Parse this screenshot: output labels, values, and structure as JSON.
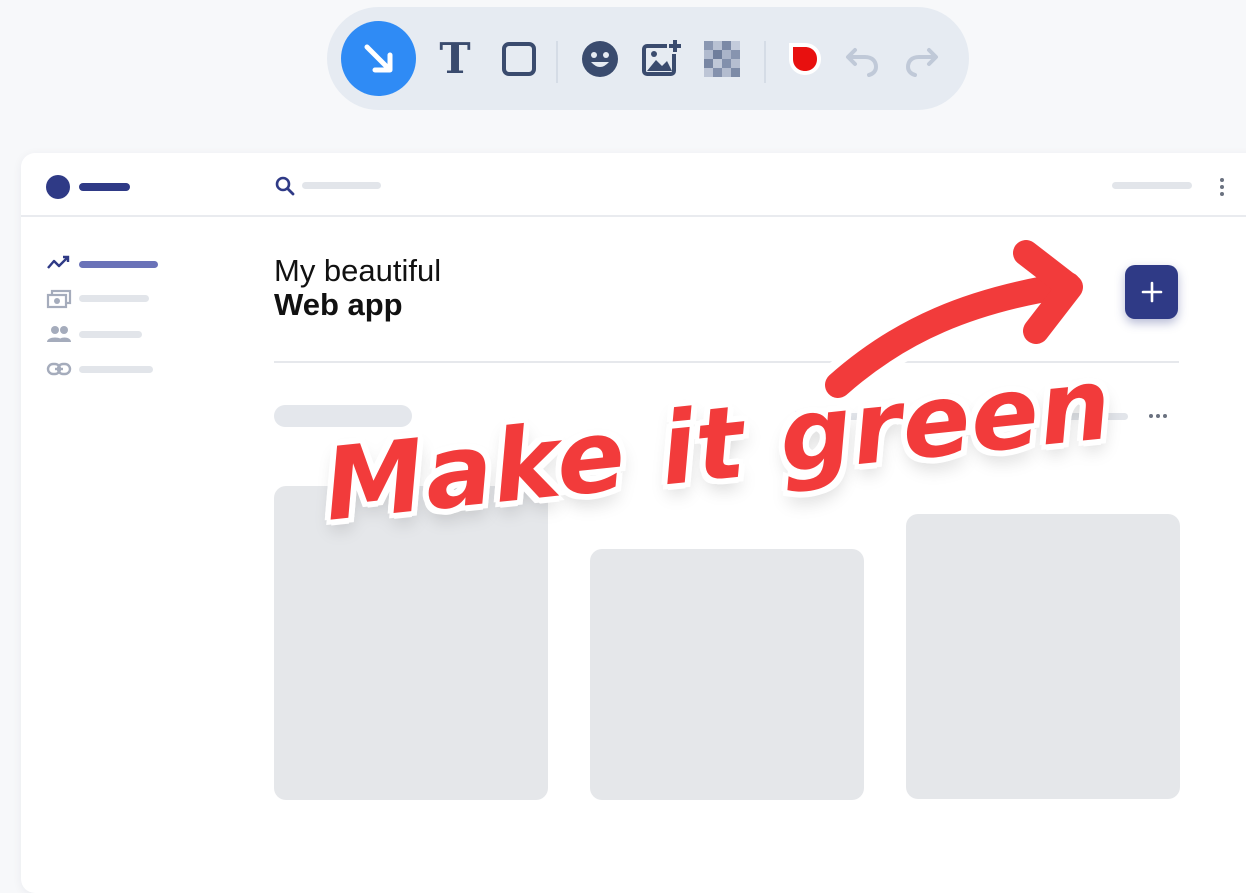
{
  "toolbar": {
    "tools": [
      {
        "icon": "arrow-icon",
        "active": true
      },
      {
        "icon": "text-icon",
        "label": "T"
      },
      {
        "icon": "rectangle-icon"
      },
      {
        "icon": "emoji-icon"
      },
      {
        "icon": "add-image-icon"
      },
      {
        "icon": "pixelate-icon"
      },
      {
        "icon": "color-picker-icon",
        "color": "#e8100f"
      },
      {
        "icon": "undo-icon"
      },
      {
        "icon": "redo-icon"
      }
    ],
    "active_color": "#2f8bf5"
  },
  "app": {
    "title_light": "My beautiful",
    "title_bold": "Web app",
    "add_button_label": "+",
    "brand_color": "#2f3a86",
    "legend_colors": [
      "#6b1be6",
      "#7fd4f7"
    ],
    "sidebar_icons": [
      "analytics-icon",
      "cash-icon",
      "people-icon",
      "link-icon"
    ]
  },
  "annotation": {
    "text": "Make it green",
    "color": "#f23b3b"
  }
}
